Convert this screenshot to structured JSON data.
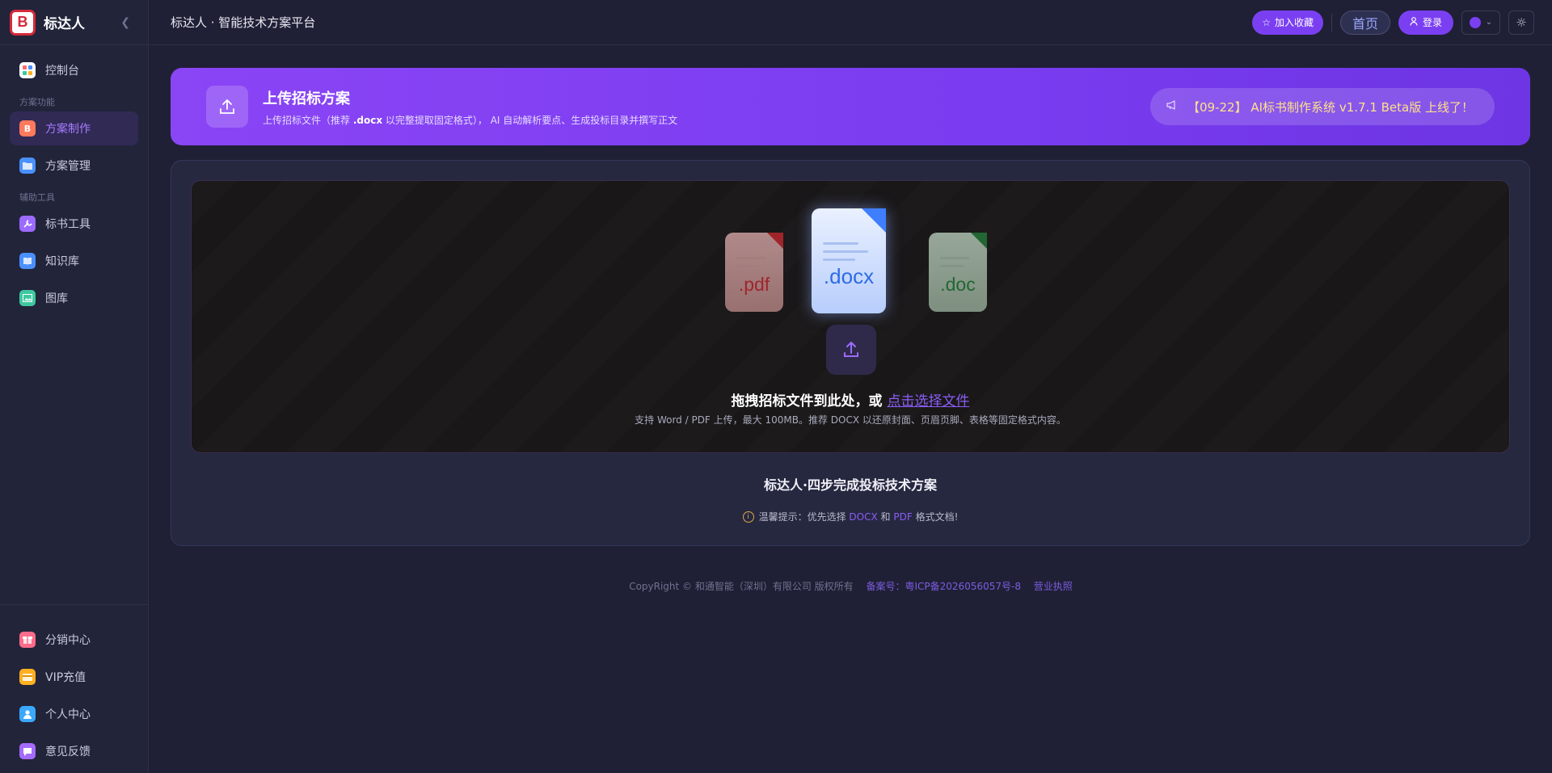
{
  "brand": {
    "name": "标达人",
    "logo_letter": "B",
    "logo_color": "#d42a3a"
  },
  "sidebar": {
    "items": [
      {
        "label": "控制台",
        "icon": "dashboard-icon",
        "color": "#ffffff"
      },
      {
        "label": "方案制作",
        "icon": "doc-make-icon",
        "color": "#ff7a5c",
        "active": true
      },
      {
        "label": "方案管理",
        "icon": "folder-icon",
        "color": "#4a90ff"
      },
      {
        "label": "标书工具",
        "icon": "wrench-icon",
        "color": "#9b6bff"
      },
      {
        "label": "知识库",
        "icon": "book-icon",
        "color": "#4a90ff"
      },
      {
        "label": "图库",
        "icon": "image-icon",
        "color": "#3fc8a0"
      }
    ],
    "sections": [
      "方案功能",
      "辅助工具"
    ],
    "bottom_items": [
      {
        "label": "分销中心",
        "icon": "gift-icon",
        "color": "#ff6b8a"
      },
      {
        "label": "VIP充值",
        "icon": "card-icon",
        "color": "#ffb020"
      },
      {
        "label": "个人中心",
        "icon": "user-icon",
        "color": "#3aa8ff"
      },
      {
        "label": "意见反馈",
        "icon": "chat-icon",
        "color": "#a46bff"
      }
    ]
  },
  "header": {
    "title": "标达人 · 智能技术方案平台",
    "favorite_label": "加入收藏",
    "home_label": "首页",
    "login_label": "登录",
    "accent_color": "#7b3ff2"
  },
  "banner": {
    "title": "上传招标方案",
    "desc_prefix": "上传招标文件（推荐 ",
    "desc_highlight": ".docx",
    "desc_suffix": " 以完整提取固定格式）， AI 自动解析要点、生成投标目录并撰写正文",
    "notice": "【09-22】 AI标书制作系统 v1.7.1 Beta版 上线了！"
  },
  "upload": {
    "file_types": [
      ".pdf",
      ".docx",
      ".doc"
    ],
    "main_text": "拖拽招标文件到此处，或 ",
    "link_text": "点击选择文件",
    "sub_text": "支持 Word / PDF 上传，最大 100MB。推荐 DOCX 以还原封面、页眉页脚、表格等固定格式内容。"
  },
  "steps_title": "标达人·四步完成投标技术方案",
  "tip": {
    "prefix": "温馨提示：优先选择 ",
    "docx": "DOCX",
    "mid": " 和 ",
    "pdf": "PDF",
    "suffix": " 格式文档!"
  },
  "footer": {
    "copyright": "CopyRight © 和通智能（深圳）有限公司 版权所有",
    "icp": "备案号：粤ICP备2026056057号-8",
    "license": "营业执照"
  }
}
